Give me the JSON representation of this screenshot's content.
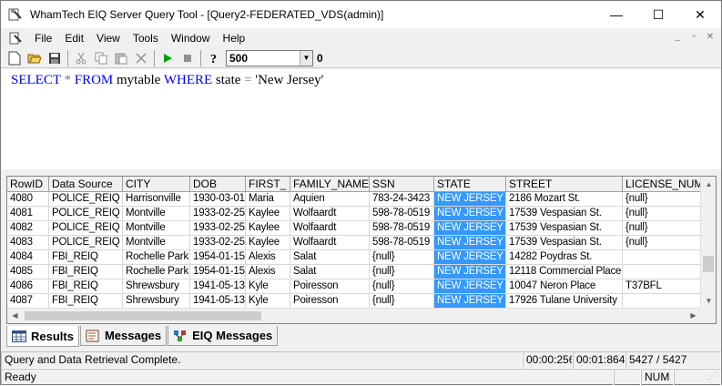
{
  "window": {
    "title": "WhamTech EIQ Server Query Tool - [Query2-FEDERATED_VDS(admin)]",
    "controls": {
      "minimize": "—",
      "maximize": "☐",
      "close": "✕"
    }
  },
  "menu": [
    "File",
    "Edit",
    "View",
    "Tools",
    "Window",
    "Help"
  ],
  "mdi_controls": {
    "minimize": "_",
    "restore": "▫",
    "close": "✕"
  },
  "toolbar": {
    "icons": [
      "new-icon",
      "open-icon",
      "save-icon",
      "cut-icon",
      "copy-icon",
      "paste-icon",
      "delete-icon",
      "run-icon",
      "stop-icon",
      "help-icon"
    ],
    "row_limit": "500",
    "row_count": "0"
  },
  "query": {
    "select": "SELECT",
    "star": "*",
    "from": "FROM",
    "table": "mytable",
    "where": "WHERE",
    "field": "state",
    "eq": "=",
    "value": "'New Jersey'"
  },
  "grid": {
    "columns": [
      "RowID",
      "Data Source",
      "CITY",
      "DOB",
      "FIRST_",
      "FAMILY_NAME",
      "SSN",
      "STATE",
      "STREET",
      "LICENSE_NUMB"
    ],
    "rows": [
      [
        "4080",
        "POLICE_REIQ",
        "Harrisonville",
        "1930-03-01",
        "Maria",
        "Aquien",
        "783-24-3423",
        "NEW JERSEY",
        "2186 Mozart St.",
        "{null}"
      ],
      [
        "4081",
        "POLICE_REIQ",
        "Montville",
        "1933-02-25",
        "Kaylee",
        "Wolfaardt",
        "598-78-0519",
        "NEW JERSEY",
        "17539 Vespasian St.",
        "{null}"
      ],
      [
        "4082",
        "POLICE_REIQ",
        "Montville",
        "1933-02-25",
        "Kaylee",
        "Wolfaardt",
        "598-78-0519",
        "NEW JERSEY",
        "17539 Vespasian St.",
        "{null}"
      ],
      [
        "4083",
        "POLICE_REIQ",
        "Montville",
        "1933-02-25",
        "Kaylee",
        "Wolfaardt",
        "598-78-0519",
        "NEW JERSEY",
        "17539 Vespasian St.",
        "{null}"
      ],
      [
        "4084",
        "FBI_REIQ",
        "Rochelle Park",
        "1954-01-15",
        "Alexis",
        "Salat",
        "{null}",
        "NEW JERSEY",
        "14282 Poydras St.",
        ""
      ],
      [
        "4085",
        "FBI_REIQ",
        "Rochelle Park",
        "1954-01-15",
        "Alexis",
        "Salat",
        "{null}",
        "NEW JERSEY",
        "12118 Commercial Place",
        ""
      ],
      [
        "4086",
        "FBI_REIQ",
        "Shrewsbury",
        "1941-05-13",
        "Kyle",
        "Poiresson",
        "{null}",
        "NEW JERSEY",
        "10047 Neron Place",
        "T37BFL"
      ],
      [
        "4087",
        "FBI_REIQ",
        "Shrewsbury",
        "1941-05-13",
        "Kyle",
        "Poiresson",
        "{null}",
        "NEW JERSEY",
        "17926 Tulane University",
        ""
      ]
    ]
  },
  "tabs": [
    "Results",
    "Messages",
    "EIQ Messages"
  ],
  "status": {
    "message": "Query and Data Retrieval Complete.",
    "time1": "00:00:256",
    "time2": "00:01:864",
    "rows": "5427 / 5427",
    "ready": "Ready",
    "num": "NUM"
  },
  "colors": {
    "selection": "#3399ff",
    "keyword": "#0000ff",
    "run_green": "#00a000"
  }
}
